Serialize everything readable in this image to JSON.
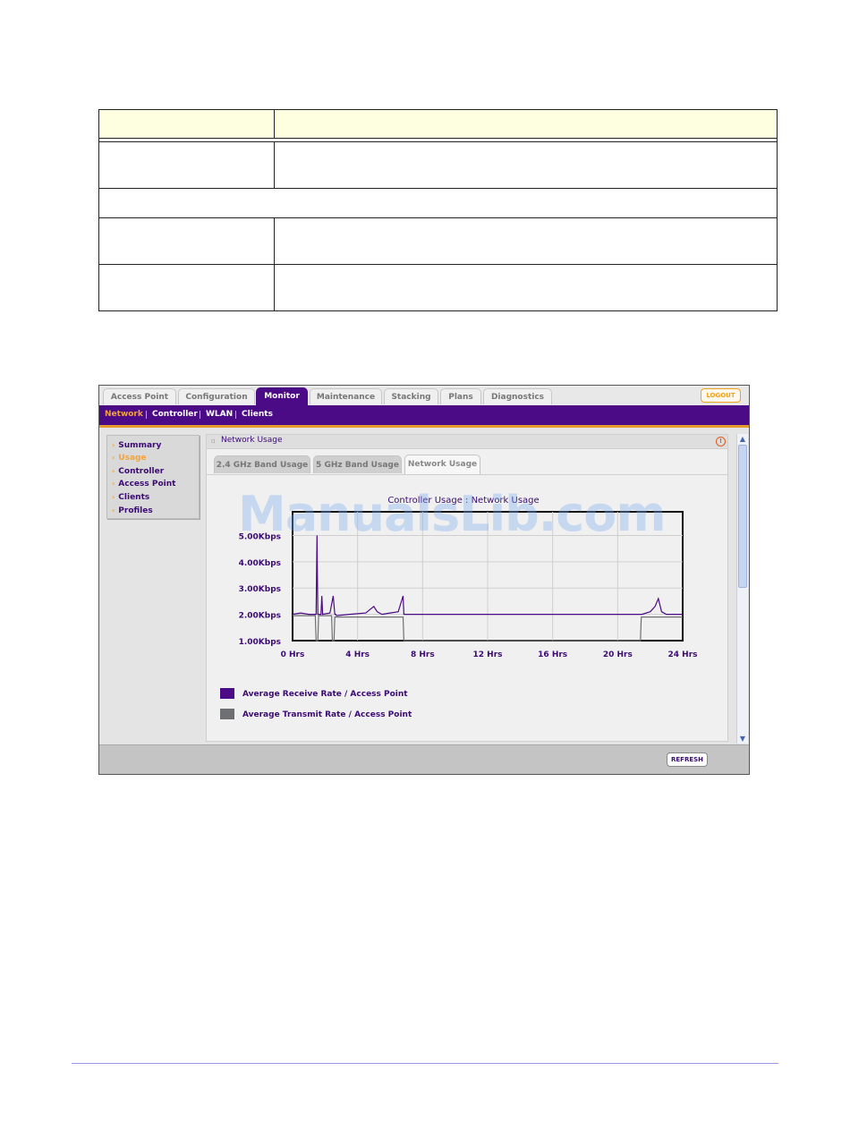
{
  "tabs": [
    "Access Point",
    "Configuration",
    "Monitor",
    "Maintenance",
    "Stacking",
    "Plans",
    "Diagnostics"
  ],
  "active_tab": "Monitor",
  "logout_label": "LOGOUT",
  "subnav": [
    "Network",
    "Controller",
    "WLAN",
    "Clients"
  ],
  "active_subnav": "Network",
  "sidebar": [
    "Summary",
    "Usage",
    "Controller",
    "Access Point",
    "Clients",
    "Profiles"
  ],
  "active_sidebar": "Usage",
  "panel": {
    "title": "Network Usage",
    "tabs": [
      "2.4 GHz Band Usage",
      "5 GHz Band Usage",
      "Network Usage"
    ],
    "active_tab": "Network Usage"
  },
  "refresh_label": "REFRESH",
  "watermark": "ManualsLib.com",
  "colors": {
    "brand": "#4b0a86",
    "accent": "#f2a33b",
    "transmit": "#6d6f73"
  },
  "chart_data": {
    "type": "line",
    "title": "Controller Usage : Network Usage",
    "x_ticks": [
      "0 Hrs",
      "4 Hrs",
      "8 Hrs",
      "12 Hrs",
      "16 Hrs",
      "20 Hrs",
      "24 Hrs"
    ],
    "y_ticks": [
      "1.00Kbps",
      "2.00Kbps",
      "3.00Kbps",
      "4.00Kbps",
      "5.00Kbps"
    ],
    "xlim": [
      0,
      24
    ],
    "ylim": [
      1,
      5.9
    ],
    "grid": true,
    "series": [
      {
        "name": "Average Receive Rate / Access Point",
        "color": "#4b0a86",
        "x": [
          0,
          0.5,
          1.0,
          1.45,
          1.5,
          1.55,
          1.6,
          1.75,
          1.8,
          1.85,
          2.3,
          2.5,
          2.6,
          2.65,
          2.7,
          3.5,
          4.5,
          5.0,
          5.2,
          5.5,
          6.0,
          6.5,
          6.8,
          6.85,
          21.5,
          22.0,
          22.3,
          22.5,
          22.7,
          23.0,
          24
        ],
        "y": [
          2.0,
          2.05,
          2.0,
          2.0,
          5.0,
          2.0,
          2.0,
          2.0,
          2.7,
          2.0,
          2.05,
          2.7,
          2.0,
          2.0,
          1.95,
          2.0,
          2.05,
          2.3,
          2.1,
          2.0,
          2.05,
          2.1,
          2.7,
          2.0,
          2.0,
          2.1,
          2.3,
          2.6,
          2.1,
          2.0,
          2.0
        ]
      },
      {
        "name": "Average Transmit Rate / Access Point",
        "color": "#6d6f73",
        "x": [
          0,
          1.4,
          1.45,
          1.55,
          1.6,
          1.75,
          1.8,
          2.4,
          2.45,
          2.55,
          2.6,
          6.8,
          6.85,
          21.4,
          21.45,
          24
        ],
        "y": [
          1.95,
          1.95,
          1.0,
          1.0,
          1.95,
          1.95,
          1.95,
          1.95,
          1.0,
          1.0,
          1.9,
          1.9,
          1.0,
          1.0,
          1.9,
          1.9
        ]
      }
    ]
  }
}
